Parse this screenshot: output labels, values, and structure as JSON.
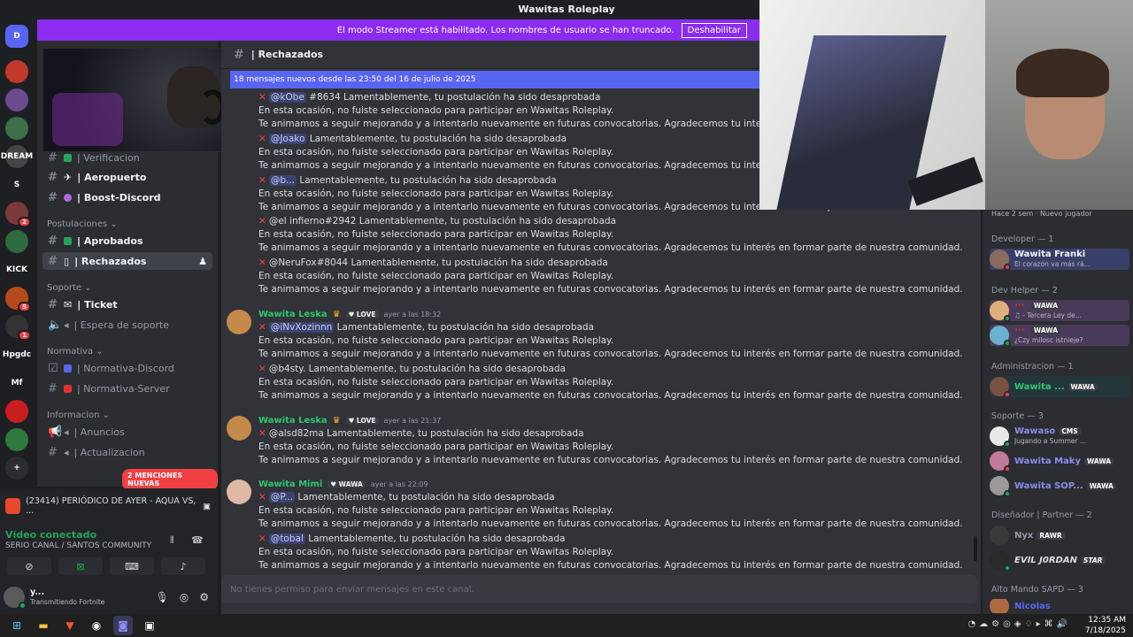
{
  "titlebar": {
    "title": "Wawitas Roleplay"
  },
  "banner": {
    "text": "El modo Streamer está habilitado. Los nombres de usuario se han truncado.",
    "button": "Deshabilitar"
  },
  "servers": [
    {
      "label": "D",
      "color": "#5865f2"
    },
    {
      "label": "",
      "color": "#c0392b"
    },
    {
      "label": "",
      "color": "#6b4b8e"
    },
    {
      "label": "",
      "color": "#3d6f4a"
    },
    {
      "label": "DREAM",
      "color": "#444444"
    },
    {
      "label": "S",
      "color": "#1e1f22"
    },
    {
      "label": "",
      "color": "#7a3a3a",
      "badge": "2"
    },
    {
      "label": "",
      "color": "#2e6b3e"
    },
    {
      "label": "KICK",
      "color": "#1e1f22"
    },
    {
      "label": "",
      "color": "#b84a1a",
      "badge": "5"
    },
    {
      "label": "",
      "color": "#333333",
      "badge": "1"
    },
    {
      "label": "Hpgdc",
      "color": "#1e1f22"
    },
    {
      "label": "Mf",
      "color": "#1e1f22"
    },
    {
      "label": "",
      "color": "#c81e1e"
    },
    {
      "label": "",
      "color": "#2f7a3a"
    },
    {
      "label": "+",
      "color": "#2b2d31"
    }
  ],
  "channels": {
    "items": [
      {
        "label": "| Verificacion",
        "cat": false
      },
      {
        "label": "| Aeropuerto",
        "bold": true
      },
      {
        "label": "| Boost-Discord",
        "bold": true
      }
    ],
    "cat_postulaciones": "Postulaciones",
    "aprobados": "| Aprobados",
    "rechazados": "| Rechazados",
    "cat_soporte": "Soporte",
    "ticket": "| Ticket",
    "espera": "| Espera de soporte",
    "cat_normativa": "Normativa",
    "norm_discord": "| Normativa-Discord",
    "norm_server": "| Normativa-Server",
    "cat_informacion": "Informacion",
    "anuncios": "| Anuncios",
    "actualizacion": "| Actualizacion",
    "mentions_badge": "2 MENCIONES NUEVAS"
  },
  "voice": {
    "now_playing": "(23414) PERIÓDICO DE AYER - AQUA VS, ...",
    "connected": "Vídeo conectado",
    "channel": "SERIO CANAL / SANTOS COMMUNITY",
    "user_name": "y...",
    "user_status": "Transmitiendo Fortnite"
  },
  "main": {
    "channel_name": "| Rechazados",
    "new_messages": "18 mensajes nuevos desde las 23:50 del 16 de julio de 2025",
    "composer": "No tienes permiso para enviar mensajes en este canal.",
    "reject_text": "Lamentablemente, tu postulación ha sido desaprobada",
    "line2": "En esta ocasión, no fuiste seleccionado para participar en Wawitas Roleplay.",
    "line3": "Te animamos a seguir mejorando y a intentarlo nuevamente en futuras convocatorias. Agradecemos tu interés en formar parte de nuestra comunidad.",
    "line3_cut": "Te animamos a seguir mejorando y a intentarlo nuevamente en futuras convocatorias. Agradecemos tu interés en formar parte",
    "m1": "@kObe",
    "m1b": "#8634",
    "m2": "@Joako",
    "m3": "@b...",
    "m4": "@el infierno#2942",
    "m5": "@NeruFox#8044",
    "author1": "Wawita Leska",
    "role_love": "LOVE",
    "time1": "ayer a las 18:32",
    "m6": "@iNvXozinnn",
    "m7": "@b4sty.",
    "time2": "ayer a las 21:37",
    "m8": "@alsd82ma",
    "author3": "Wawita Mimi",
    "role_wawa": "WAWA",
    "time3": "ayer a las 22:09",
    "m9": "@P...",
    "m10": "@tobal"
  },
  "members": {
    "top_status_a": "Hace 2 sem",
    "top_status_b": "Nuevo jugador",
    "cat_developer": "Developer — 1",
    "dev1_name": "Wawita Franki",
    "dev1_status": "El corazón va más rá...",
    "cat_devhelper": "Dev Helper — 2",
    "dh1_tag": "WAWA",
    "dh1_status": "♫ - Tercera Ley de...",
    "dh2_tag": "WAWA",
    "dh2_status": "¿Czy milosc istnieje?",
    "cat_admin": "Administracion — 1",
    "ad1_name": "Wawita ...",
    "ad1_tag": "WAWA",
    "cat_soporte": "Soporte — 3",
    "s1_name": "Wawaso",
    "s1_tag": "CMS",
    "s1_status": "Jugando a Summer ...",
    "s2_name": "Wawita Maky",
    "s2_tag": "WAWA",
    "s3_name": "Wawita SOP...",
    "s3_tag": "WAWA",
    "cat_disenador": "Diseñador | Partner — 2",
    "d1_name": "Nyx",
    "d1_tag": "RAWR",
    "d2_name": "EVIL J0RDAN",
    "d2_tag": "STAR",
    "cat_alto": "Alto Mando SAPD — 3",
    "a1_name": "Nicolas"
  },
  "taskbar": {
    "time": "12:35 AM",
    "date": "7/18/2025"
  }
}
